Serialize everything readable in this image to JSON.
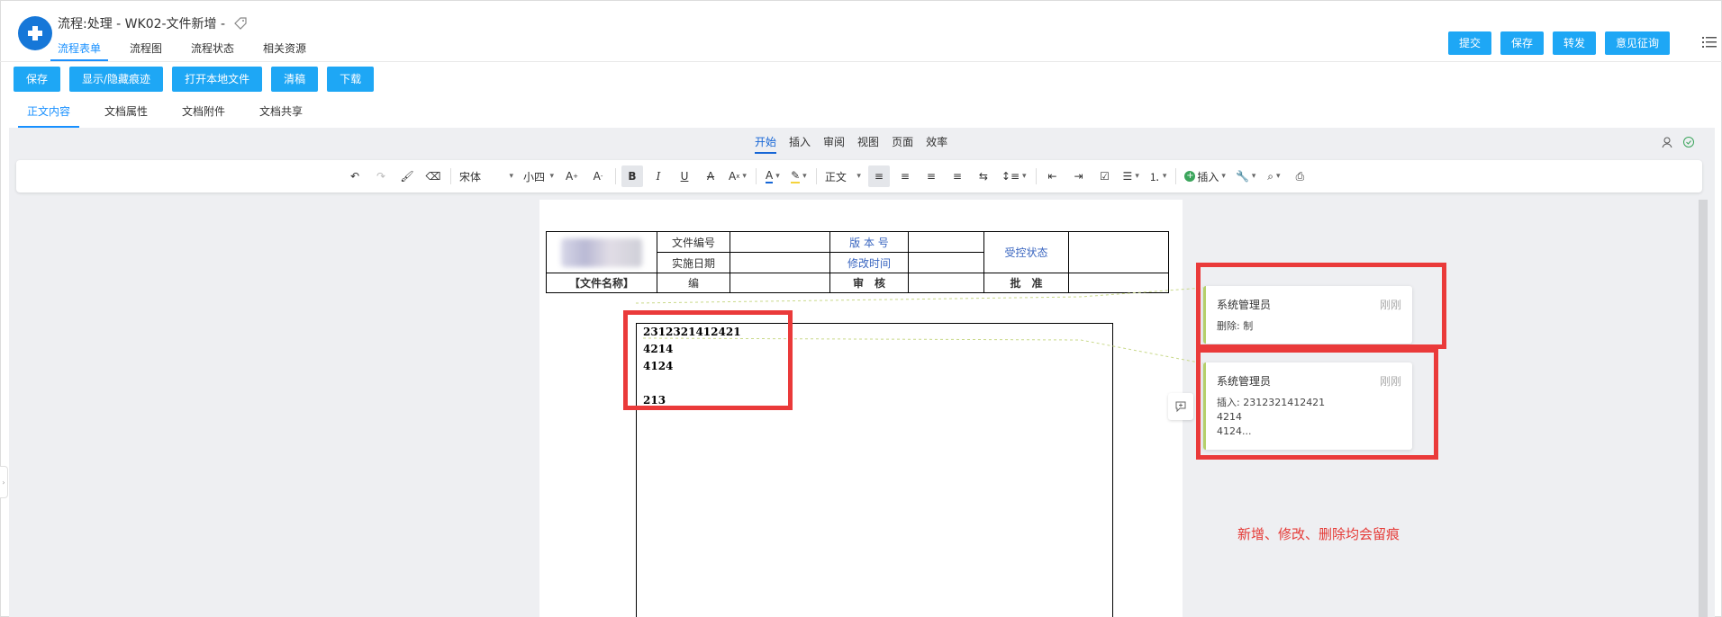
{
  "header": {
    "title": "流程:处理 - WK02-文件新增 -",
    "tabs": [
      "流程表单",
      "流程图",
      "流程状态",
      "相关资源"
    ],
    "buttons": [
      "提交",
      "保存",
      "转发",
      "意见征询"
    ]
  },
  "actions": [
    "保存",
    "显示/隐藏痕迹",
    "打开本地文件",
    "清稿",
    "下载"
  ],
  "doc_tabs": [
    "正文内容",
    "文档属性",
    "文档附件",
    "文档共享"
  ],
  "menu_tabs": [
    "开始",
    "插入",
    "审阅",
    "视图",
    "页面",
    "效率"
  ],
  "toolbar": {
    "font": "宋体",
    "size": "小四",
    "para_style": "正文",
    "insert": "插入"
  },
  "table": {
    "file_number_label": "文件编号",
    "version_label": "版 本 号",
    "control_status_label": "受控状态",
    "effective_date_label": "实施日期",
    "revision_time_label": "修改时间",
    "file_name_label": "【文件名称】",
    "compile_label": "编",
    "review_label": "审　核",
    "approve_label": "批　准"
  },
  "body_lines": [
    "2312321412421",
    "4214",
    "4124",
    "",
    "213"
  ],
  "comments": [
    {
      "author": "系统管理员",
      "time": "刚刚",
      "text": "删除: 制"
    },
    {
      "author": "系统管理员",
      "time": "刚刚",
      "text": "插入: 2312321412421\n4214\n4124..."
    }
  ],
  "annotation_note": "新增、修改、删除均会留痕",
  "colors": {
    "primary": "#1ea7f5",
    "tab_active": "#1890ff",
    "highlight": "#ea3a3a",
    "note": "#e53935"
  }
}
